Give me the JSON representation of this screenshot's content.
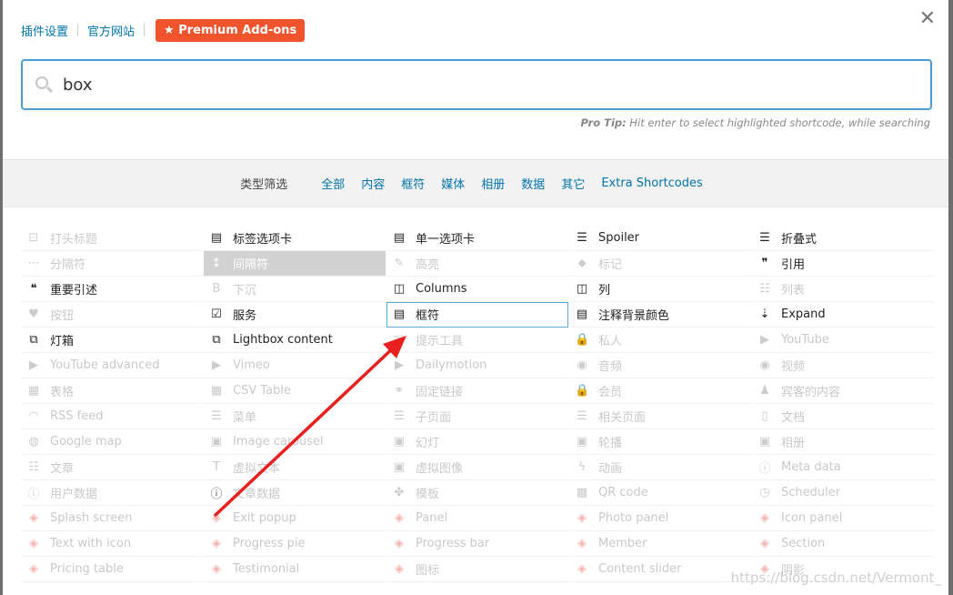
{
  "top_links": {
    "plugin_settings": "插件设置",
    "official_site": "官方网站",
    "premium": "★ Premium Add-ons"
  },
  "close_glyph": "✕",
  "search": {
    "value": "box",
    "placeholder": ""
  },
  "pro_tip": {
    "label": "Pro Tip:",
    "text": " Hit enter to select highlighted shortcode, while searching"
  },
  "filters": {
    "label": "类型筛选",
    "items": [
      "全部",
      "内容",
      "框符",
      "媒体",
      "相册",
      "数据",
      "其它",
      "Extra Shortcodes"
    ]
  },
  "shortcodes": [
    {
      "label": "打头标题",
      "icon": "heading-icon",
      "glyph": "⊡",
      "state": "disabled"
    },
    {
      "label": "标签选项卡",
      "icon": "tabs-icon",
      "glyph": "▤",
      "state": "enabled"
    },
    {
      "label": "单一选项卡",
      "icon": "tab-icon",
      "glyph": "▤",
      "state": "enabled"
    },
    {
      "label": "Spoiler",
      "icon": "list-icon",
      "glyph": "☰",
      "state": "enabled"
    },
    {
      "label": "折叠式",
      "icon": "list-icon",
      "glyph": "☰",
      "state": "enabled"
    },
    {
      "label": "分隔符",
      "icon": "ellipsis-icon",
      "glyph": "⋯",
      "state": "disabled"
    },
    {
      "label": "间隔符",
      "icon": "spacer-icon",
      "glyph": "↕",
      "state": "highlight-gray"
    },
    {
      "label": "高亮",
      "icon": "pencil-icon",
      "glyph": "✎",
      "state": "disabled"
    },
    {
      "label": "标记",
      "icon": "tag-icon",
      "glyph": "⬥",
      "state": "disabled"
    },
    {
      "label": "引用",
      "icon": "quote-icon",
      "glyph": "❞",
      "state": "enabled"
    },
    {
      "label": "重要引述",
      "icon": "quote-left-icon",
      "glyph": "❝",
      "state": "enabled"
    },
    {
      "label": "下沉",
      "icon": "bold-icon",
      "glyph": "B",
      "state": "disabled"
    },
    {
      "label": "Columns",
      "icon": "columns-icon",
      "glyph": "◫",
      "state": "enabled"
    },
    {
      "label": "列",
      "icon": "columns-icon",
      "glyph": "◫",
      "state": "enabled"
    },
    {
      "label": "列表",
      "icon": "list-ul-icon",
      "glyph": "☷",
      "state": "disabled"
    },
    {
      "label": "按钮",
      "icon": "heart-icon",
      "glyph": "♥",
      "state": "disabled"
    },
    {
      "label": "服务",
      "icon": "checkbox-icon",
      "glyph": "☑",
      "state": "enabled"
    },
    {
      "label": "框符",
      "icon": "box-icon",
      "glyph": "▤",
      "state": "highlight-box"
    },
    {
      "label": "注释背景颜色",
      "icon": "note-icon",
      "glyph": "▤",
      "state": "enabled"
    },
    {
      "label": "Expand",
      "icon": "sort-icon",
      "glyph": "⇣",
      "state": "enabled"
    },
    {
      "label": "灯箱",
      "icon": "external-link-icon",
      "glyph": "⧉",
      "state": "enabled"
    },
    {
      "label": "Lightbox content",
      "icon": "external-link-icon",
      "glyph": "⧉",
      "state": "enabled"
    },
    {
      "label": "提示工具",
      "icon": "comment-icon",
      "glyph": "✉",
      "state": "disabled"
    },
    {
      "label": "私人",
      "icon": "lock-icon",
      "glyph": "🔒",
      "state": "disabled"
    },
    {
      "label": "YouTube",
      "icon": "youtube-icon",
      "glyph": "▶",
      "state": "disabled"
    },
    {
      "label": "YouTube advanced",
      "icon": "youtube-icon",
      "glyph": "▶",
      "state": "disabled"
    },
    {
      "label": "Vimeo",
      "icon": "youtube-icon",
      "glyph": "▶",
      "state": "disabled"
    },
    {
      "label": "Dailymotion",
      "icon": "play-circle-icon",
      "glyph": "▶",
      "state": "disabled"
    },
    {
      "label": "音频",
      "icon": "play-circle-icon",
      "glyph": "◉",
      "state": "disabled"
    },
    {
      "label": "视频",
      "icon": "play-circle-icon",
      "glyph": "◉",
      "state": "disabled"
    },
    {
      "label": "表格",
      "icon": "table-icon",
      "glyph": "▦",
      "state": "disabled"
    },
    {
      "label": "CSV Table",
      "icon": "table-icon",
      "glyph": "▦",
      "state": "disabled"
    },
    {
      "label": "固定链接",
      "icon": "link-icon",
      "glyph": "⚭",
      "state": "disabled"
    },
    {
      "label": "会员",
      "icon": "lock-icon",
      "glyph": "🔒",
      "state": "disabled"
    },
    {
      "label": "宾客的内容",
      "icon": "user-icon",
      "glyph": "♟",
      "state": "disabled"
    },
    {
      "label": "RSS feed",
      "icon": "rss-icon",
      "glyph": "◠",
      "state": "disabled"
    },
    {
      "label": "菜单",
      "icon": "bars-icon",
      "glyph": "☰",
      "state": "disabled"
    },
    {
      "label": "子页面",
      "icon": "bars-icon",
      "glyph": "☰",
      "state": "disabled"
    },
    {
      "label": "相关页面",
      "icon": "bars-icon",
      "glyph": "☰",
      "state": "disabled"
    },
    {
      "label": "文档",
      "icon": "file-icon",
      "glyph": "▯",
      "state": "disabled"
    },
    {
      "label": "Google map",
      "icon": "globe-icon",
      "glyph": "◍",
      "state": "disabled"
    },
    {
      "label": "Image carousel",
      "icon": "image-icon",
      "glyph": "▣",
      "state": "disabled"
    },
    {
      "label": "幻灯",
      "icon": "image-icon",
      "glyph": "▣",
      "state": "disabled"
    },
    {
      "label": "轮播",
      "icon": "image-icon",
      "glyph": "▣",
      "state": "disabled"
    },
    {
      "label": "相册",
      "icon": "image-icon",
      "glyph": "▣",
      "state": "disabled"
    },
    {
      "label": "文章",
      "icon": "th-list-icon",
      "glyph": "☷",
      "state": "disabled"
    },
    {
      "label": "虚拟文本",
      "icon": "text-height-icon",
      "glyph": "T",
      "state": "disabled"
    },
    {
      "label": "虚拟图像",
      "icon": "image-icon",
      "glyph": "▣",
      "state": "disabled"
    },
    {
      "label": "动画",
      "icon": "bolt-icon",
      "glyph": "ϟ",
      "state": "disabled"
    },
    {
      "label": "Meta data",
      "icon": "info-icon",
      "glyph": "ⓘ",
      "state": "disabled"
    },
    {
      "label": "用户数据",
      "icon": "info-icon",
      "glyph": "ⓘ",
      "state": "disabled"
    },
    {
      "label": "文章数据",
      "icon": "info-icon",
      "glyph": "ⓘ",
      "state": "enabled-icon"
    },
    {
      "label": "模板",
      "icon": "puzzle-icon",
      "glyph": "✤",
      "state": "disabled"
    },
    {
      "label": "QR code",
      "icon": "qrcode-icon",
      "glyph": "▩",
      "state": "disabled"
    },
    {
      "label": "Scheduler",
      "icon": "clock-icon",
      "glyph": "◷",
      "state": "disabled"
    },
    {
      "label": "Splash screen",
      "icon": "layers-icon",
      "glyph": "◈",
      "state": "pink"
    },
    {
      "label": "Exit popup",
      "icon": "layers-icon",
      "glyph": "◈",
      "state": "pink"
    },
    {
      "label": "Panel",
      "icon": "layers-icon",
      "glyph": "◈",
      "state": "pink"
    },
    {
      "label": "Photo panel",
      "icon": "layers-icon",
      "glyph": "◈",
      "state": "pink"
    },
    {
      "label": "Icon panel",
      "icon": "layers-icon",
      "glyph": "◈",
      "state": "pink"
    },
    {
      "label": "Text with icon",
      "icon": "layers-icon",
      "glyph": "◈",
      "state": "pink"
    },
    {
      "label": "Progress pie",
      "icon": "layers-icon",
      "glyph": "◈",
      "state": "pink"
    },
    {
      "label": "Progress bar",
      "icon": "layers-icon",
      "glyph": "◈",
      "state": "pink"
    },
    {
      "label": "Member",
      "icon": "layers-icon",
      "glyph": "◈",
      "state": "pink"
    },
    {
      "label": "Section",
      "icon": "layers-icon",
      "glyph": "◈",
      "state": "pink"
    },
    {
      "label": "Pricing table",
      "icon": "layers-icon",
      "glyph": "◈",
      "state": "pink"
    },
    {
      "label": "Testimonial",
      "icon": "layers-icon",
      "glyph": "◈",
      "state": "pink"
    },
    {
      "label": "图标",
      "icon": "layers-icon",
      "glyph": "◈",
      "state": "pink"
    },
    {
      "label": "Content slider",
      "icon": "layers-icon",
      "glyph": "◈",
      "state": "pink"
    },
    {
      "label": "阴影",
      "icon": "layers-icon",
      "glyph": "◈",
      "state": "pink"
    }
  ],
  "watermark": "https://blog.csdn.net/Vermont_",
  "colors": {
    "accent": "#0073aa",
    "premium": "#f0542d",
    "search_border": "#4a9ed6",
    "arrow": "#e8201e"
  }
}
